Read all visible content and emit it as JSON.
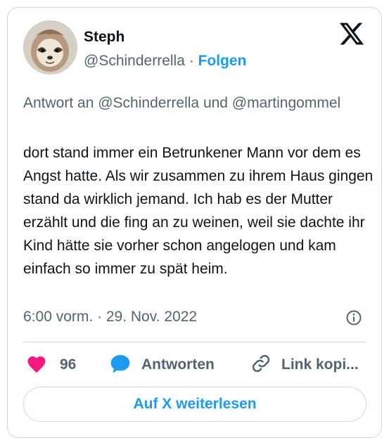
{
  "author": {
    "display_name": "Steph",
    "handle": "@Schinderrella",
    "separator": " · ",
    "follow_label": "Folgen",
    "avatar_icon": "sloth-avatar"
  },
  "brand": {
    "logo_icon": "x-logo-icon"
  },
  "tweet": {
    "reply_to": "Antwort an @Schinderrella und @martingommel",
    "text": "dort stand immer ein Betrunkener Mann vor dem es Angst hatte. Als wir zusammen zu ihrem Haus gingen stand da wirklich jemand. Ich hab es der Mutter erzählt und die fing an zu weinen, weil sie dachte ihr Kind hätte sie vorher schon angelogen und kam einfach so immer zu spät heim.",
    "timestamp": "6:00 vorm. · 29. Nov. 2022",
    "info_icon": "info-icon"
  },
  "actions": {
    "like_count": "96",
    "like_icon": "heart-icon",
    "reply_label": "Antworten",
    "reply_icon": "speech-bubble-icon",
    "link_label": "Link kopi...",
    "link_icon": "link-icon"
  },
  "cta": {
    "label": "Auf X weiterlesen"
  },
  "colors": {
    "accent": "#1d9bf0",
    "heart": "#f91880",
    "muted": "#536471",
    "text": "#0f1419",
    "border": "#cfd9de"
  }
}
